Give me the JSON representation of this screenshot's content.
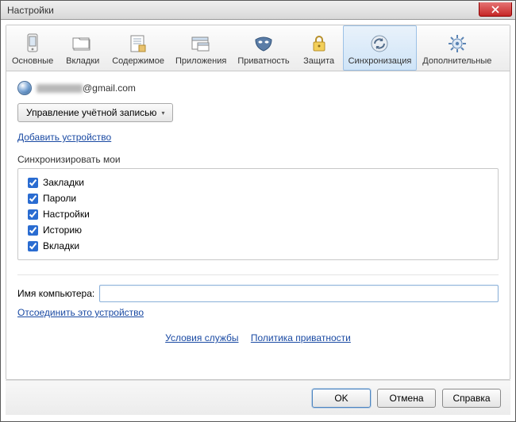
{
  "window": {
    "title": "Настройки"
  },
  "tabs": {
    "general": {
      "label": "Основные"
    },
    "vkladki": {
      "label": "Вкладки"
    },
    "content": {
      "label": "Содержимое"
    },
    "apps": {
      "label": "Приложения"
    },
    "privacy": {
      "label": "Приватность"
    },
    "security": {
      "label": "Защита"
    },
    "sync": {
      "label": "Синхронизация"
    },
    "advanced": {
      "label": "Дополнительные"
    }
  },
  "account": {
    "email_domain": "@gmail.com",
    "manage_button": "Управление учётной записью",
    "add_device_link": "Добавить устройство"
  },
  "sync": {
    "section_label": "Синхронизировать мои",
    "items": [
      {
        "label": "Закладки",
        "checked": true
      },
      {
        "label": "Пароли",
        "checked": true
      },
      {
        "label": "Настройки",
        "checked": true
      },
      {
        "label": "Историю",
        "checked": true
      },
      {
        "label": "Вкладки",
        "checked": true
      }
    ]
  },
  "computer": {
    "label": "Имя компьютера:",
    "value": "",
    "unlink_link": "Отсоединить это устройство"
  },
  "bottom_links": {
    "terms": "Условия службы",
    "privacy": "Политика приватности"
  },
  "buttons": {
    "ok": "OK",
    "cancel": "Отмена",
    "help": "Справка"
  }
}
